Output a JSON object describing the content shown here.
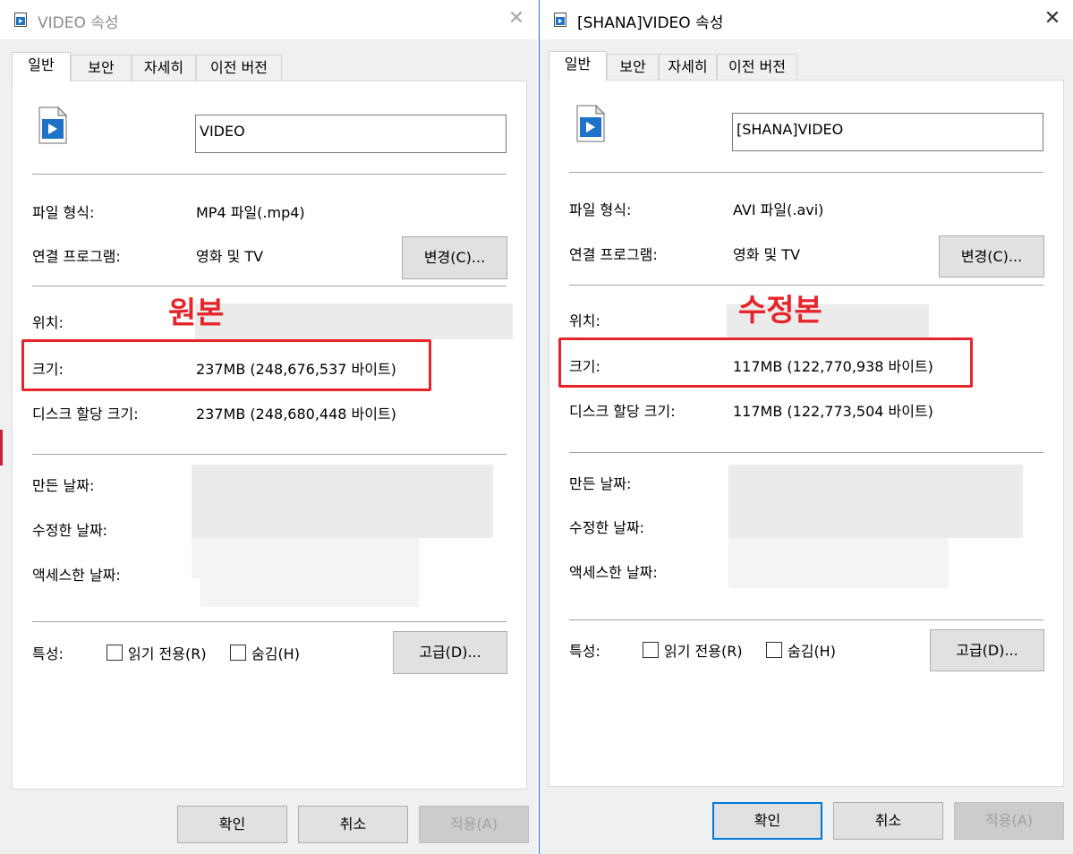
{
  "left": {
    "title": "VIDEO 속성",
    "tabs": [
      "일반",
      "보안",
      "자세히",
      "이전 버전"
    ],
    "name_value": "VIDEO",
    "rows": {
      "file_type_label": "파일 형식:",
      "file_type_value": "MP4 파일(.mp4)",
      "opens_with_label": "연결 프로그램:",
      "opens_with_value": "영화 및 TV",
      "change_button": "변경(C)...",
      "location_label": "위치:",
      "size_label": "크기:",
      "size_value": "237MB (248,676,537 바이트)",
      "disk_size_label": "디스크 할당 크기:",
      "disk_size_value": "237MB (248,680,448 바이트)",
      "created_label": "만든 날짜:",
      "modified_label": "수정한 날짜:",
      "accessed_label": "액세스한 날짜:",
      "attributes_label": "특성:",
      "readonly_label": "읽기 전용(R)",
      "hidden_label": "숨김(H)",
      "advanced_button": "고급(D)..."
    },
    "annotation": "원본",
    "buttons": {
      "ok": "확인",
      "cancel": "취소",
      "apply": "적용(A)"
    }
  },
  "right": {
    "title": "[SHANA]VIDEO 속성",
    "tabs": [
      "일반",
      "보안",
      "자세히",
      "이전 버전"
    ],
    "name_value": "[SHANA]VIDEO",
    "rows": {
      "file_type_label": "파일 형식:",
      "file_type_value": "AVI 파일(.avi)",
      "opens_with_label": "연결 프로그램:",
      "opens_with_value": "영화 및 TV",
      "change_button": "변경(C)...",
      "location_label": "위치:",
      "size_label": "크기:",
      "size_value": "117MB (122,770,938 바이트)",
      "disk_size_label": "디스크 할당 크기:",
      "disk_size_value": "117MB (122,773,504 바이트)",
      "created_label": "만든 날짜:",
      "modified_label": "수정한 날짜:",
      "accessed_label": "액세스한 날짜:",
      "attributes_label": "특성:",
      "readonly_label": "읽기 전용(R)",
      "hidden_label": "숨김(H)",
      "advanced_button": "고급(D)..."
    },
    "annotation": "수정본",
    "buttons": {
      "ok": "확인",
      "cancel": "취소",
      "apply": "적용(A)"
    }
  },
  "colors": {
    "annotation_red": "#e8242b",
    "accent_blue": "#0078d7",
    "dialog_bg": "#f0f0f0"
  }
}
